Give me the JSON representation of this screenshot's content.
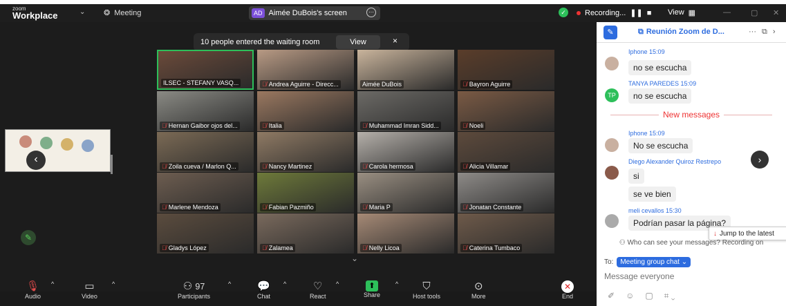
{
  "window": {
    "brand_small": "zoom",
    "brand_large": "Workplace",
    "meeting_label": "Meeting",
    "screen_owner": "Aimée DuBois's screen",
    "screen_badge": "AD",
    "recording": "Recording...",
    "view": "View"
  },
  "notice": {
    "text": "10 people entered the waiting room",
    "view": "View",
    "close": "×"
  },
  "participants": [
    {
      "name": "ILSEC - STEFANY VASQ...",
      "muted": false,
      "color": "#6b4a3a"
    },
    {
      "name": "Andrea Aguirre - Direcc...",
      "muted": true,
      "color": "#b89a84"
    },
    {
      "name": "Aimée DuBois",
      "muted": false,
      "color": "#c9b49c"
    },
    {
      "name": "Bayron Aguirre",
      "muted": true,
      "color": "#5a3d2a"
    },
    {
      "name": "Hernan Gaibor ojos del...",
      "muted": true,
      "color": "#8a8a84"
    },
    {
      "name": "Italia",
      "muted": true,
      "color": "#9a7860"
    },
    {
      "name": "Muhammad Imran Sidd...",
      "muted": true,
      "color": "#6c6a66"
    },
    {
      "name": "Noeli",
      "muted": true,
      "color": "#7a5a44"
    },
    {
      "name": "Zoila cueva / Marlon Q...",
      "muted": true,
      "color": "#7b6a55"
    },
    {
      "name": "Nancy Martinez",
      "muted": true,
      "color": "#8f7a64"
    },
    {
      "name": "Carola hermosa",
      "muted": true,
      "color": "#b5b0aa"
    },
    {
      "name": "Alicia Villamar",
      "muted": true,
      "color": "#5d4a3c"
    },
    {
      "name": "Marlene Mendoza",
      "muted": true,
      "color": "#6d5d50"
    },
    {
      "name": "Fabian Pazmiño",
      "muted": true,
      "color": "#6e7a3a"
    },
    {
      "name": "Maria P",
      "muted": true,
      "color": "#9a8f82"
    },
    {
      "name": "Jonatan Constante",
      "muted": true,
      "color": "#8e8b88"
    },
    {
      "name": "Gladys López",
      "muted": true,
      "color": "#5b4c3e"
    },
    {
      "name": "Zalamea",
      "muted": true,
      "color": "#7a6a5d"
    },
    {
      "name": "Nelly Licoa",
      "muted": true,
      "color": "#a68a76"
    },
    {
      "name": "Caterina Tumbaco",
      "muted": true,
      "color": "#6e5a4a"
    }
  ],
  "toolbar": {
    "audio": "Audio",
    "video": "Video",
    "participants": "Participants",
    "participant_count": "97",
    "chat": "Chat",
    "react": "React",
    "share": "Share",
    "host_tools": "Host tools",
    "more": "More",
    "end": "End"
  },
  "chat": {
    "title": "Reunión Zoom de D...",
    "messages": [
      {
        "sender": "Iphone",
        "time": "15:09",
        "text": "no se escucha",
        "avatar": ""
      },
      {
        "sender": "TANYA PAREDES",
        "time": "15:09",
        "text": "no se escucha",
        "avatar": "TP"
      },
      {
        "sender": "Iphone",
        "time": "15:09",
        "text": "No se escucha",
        "avatar": ""
      },
      {
        "sender": "Diego Alexander Quiroz Restrepo",
        "time": "",
        "text": "si",
        "avatar": ""
      },
      {
        "sender": "",
        "time": "",
        "text": "se ve bien",
        "avatar": ""
      },
      {
        "sender": "meli cevallos",
        "time": "15:30",
        "text": "Podrían pasar la página?",
        "avatar": ""
      }
    ],
    "new_messages": "New messages",
    "jump": "Jump to the latest",
    "privacy": "Who can see your messages? Recording on",
    "to_label": "To:",
    "to_target": "Meeting group chat",
    "placeholder": "Message everyone"
  },
  "colors": {
    "accent": "#2d6cdf",
    "active_speaker": "#2dbf5a",
    "muted": "#e84c4c",
    "new_messages": "#e33333"
  }
}
